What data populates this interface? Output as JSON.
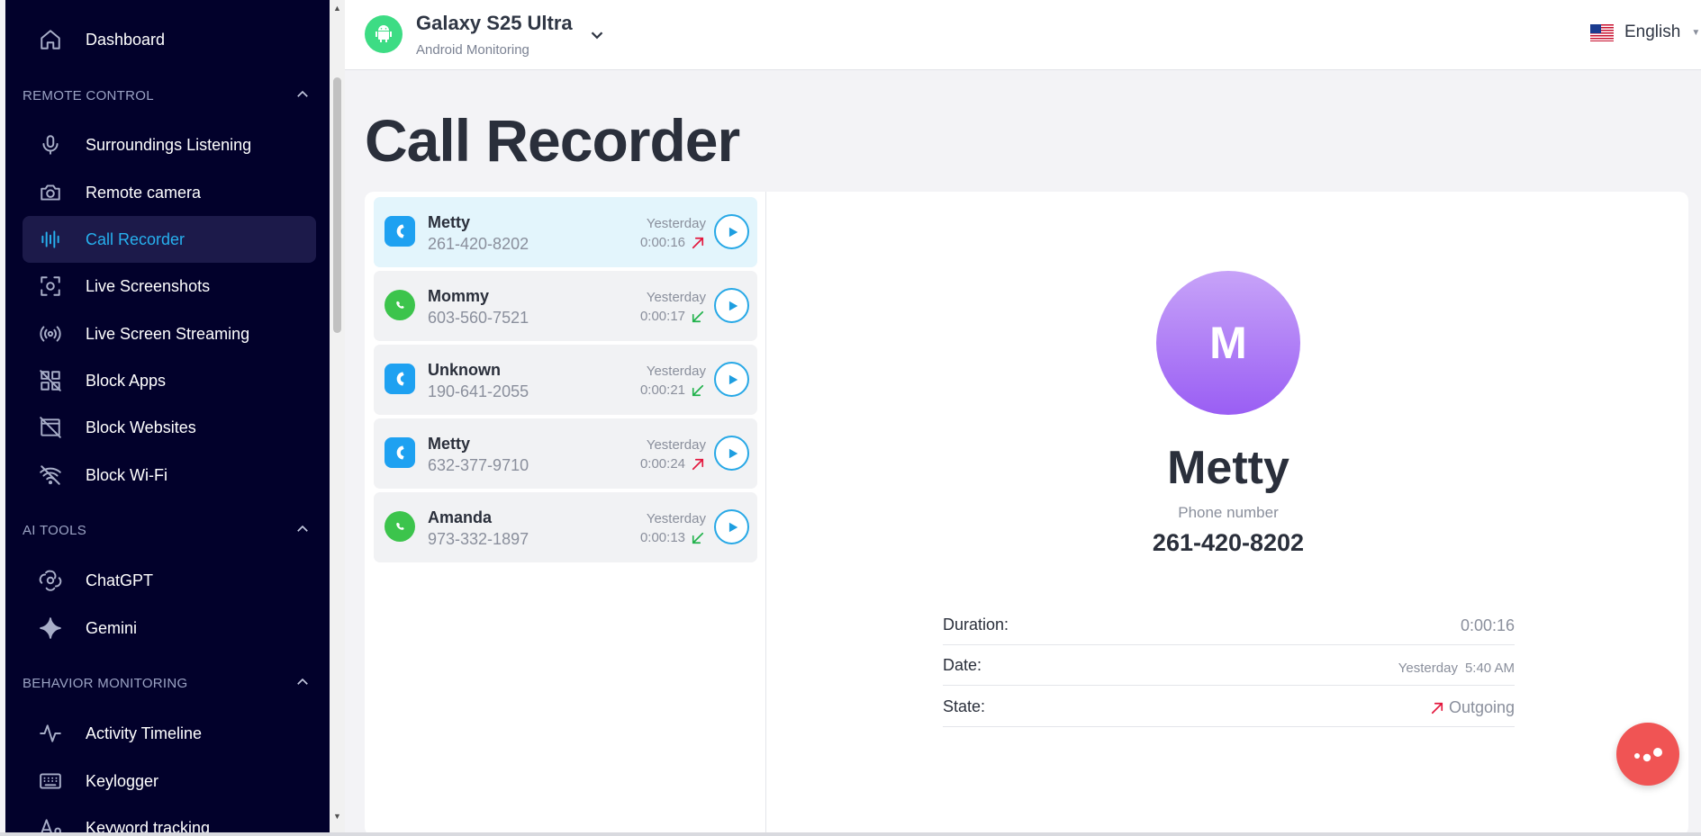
{
  "sidebar": {
    "dashboard": "Dashboard",
    "sections": {
      "remote_control": "REMOTE CONTROL",
      "ai_tools": "AI TOOLS",
      "behavior_monitoring": "BEHAVIOR MONITORING"
    },
    "items": {
      "surroundings": "Surroundings Listening",
      "camera": "Remote camera",
      "call_recorder": "Call Recorder",
      "screenshots": "Live Screenshots",
      "streaming": "Live Screen Streaming",
      "block_apps": "Block Apps",
      "block_websites": "Block Websites",
      "block_wifi": "Block Wi-Fi",
      "chatgpt": "ChatGPT",
      "gemini": "Gemini",
      "activity": "Activity Timeline",
      "keylogger": "Keylogger",
      "keyword": "Keyword tracking"
    },
    "active_item": "Call Recorder"
  },
  "header": {
    "device_name": "Galaxy S25 Ultra",
    "device_sub": "Android Monitoring",
    "language": "English"
  },
  "page": {
    "title": "Call Recorder"
  },
  "calls": [
    {
      "name": "Metty",
      "number": "261-420-8202",
      "day": "Yesterday",
      "duration": "0:00:16",
      "direction": "outgoing",
      "app": "phone",
      "selected": true
    },
    {
      "name": "Mommy",
      "number": "603-560-7521",
      "day": "Yesterday",
      "duration": "0:00:17",
      "direction": "incoming",
      "app": "whatsapp",
      "selected": false
    },
    {
      "name": "Unknown",
      "number": "190-641-2055",
      "day": "Yesterday",
      "duration": "0:00:21",
      "direction": "incoming",
      "app": "phone",
      "selected": false
    },
    {
      "name": "Metty",
      "number": "632-377-9710",
      "day": "Yesterday",
      "duration": "0:00:24",
      "direction": "outgoing",
      "app": "phone",
      "selected": false
    },
    {
      "name": "Amanda",
      "number": "973-332-1897",
      "day": "Yesterday",
      "duration": "0:00:13",
      "direction": "incoming",
      "app": "whatsapp",
      "selected": false
    }
  ],
  "detail": {
    "initial": "M",
    "name": "Metty",
    "phone_label": "Phone number",
    "phone": "261-420-8202",
    "duration_label": "Duration:",
    "duration": "0:00:16",
    "date_label": "Date:",
    "date_day": "Yesterday",
    "date_time": "5:40 AM",
    "state_label": "State:",
    "state": "Outgoing"
  },
  "colors": {
    "sidebar_bg": "#02012b",
    "accent": "#27b0ee",
    "outgoing": "#e3183e",
    "incoming": "#22b24c",
    "fab": "#f05454"
  }
}
